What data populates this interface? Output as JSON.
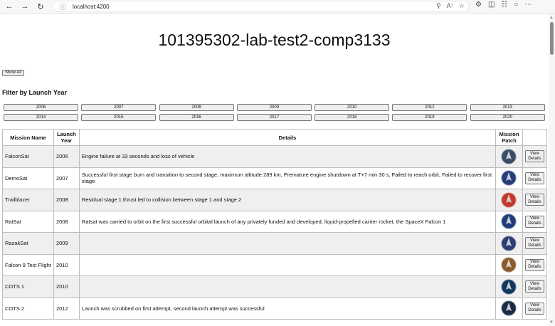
{
  "browser": {
    "url": "localhost:4200"
  },
  "page": {
    "title": "101395302-lab-test2-comp3133",
    "show_all_label": "Show All",
    "filter_heading": "Filter by Launch Year",
    "years": [
      "2006",
      "2007",
      "2008",
      "2009",
      "2010",
      "2012",
      "2013",
      "2014",
      "2015",
      "2016",
      "2017",
      "2018",
      "2019",
      "2020"
    ]
  },
  "table": {
    "headers": {
      "name": "Mission Name",
      "year_line1": "Launch",
      "year_line2": "Year",
      "details": "Details",
      "patch_line1": "Mission",
      "patch_line2": "Patch"
    },
    "view_label_line1": "View",
    "view_label_line2": "Details",
    "rows": [
      {
        "name": "FalconSat",
        "year": "2006",
        "details": "Engine failure at 33 seconds and loss of vehicle",
        "patch_color": "#3a4b66"
      },
      {
        "name": "DemoSat",
        "year": "2007",
        "details": "Successful first stage burn and transition to second stage, maximum altitude 289 km, Premature engine shutdown at T+7 min 30 s, Failed to reach orbit, Failed to recover first stage",
        "patch_color": "#263d7a"
      },
      {
        "name": "Trailblazer",
        "year": "2008",
        "details": "Residual stage 1 thrust led to collision between stage 1 and stage 2",
        "patch_color": "#c0392b"
      },
      {
        "name": "RatSat",
        "year": "2008",
        "details": "Ratsat was carried to orbit on the first successful orbital launch of any privately funded and developed, liquid-propelled carrier rocket, the SpaceX Falcon 1",
        "patch_color": "#1f3d7a"
      },
      {
        "name": "RazakSat",
        "year": "2009",
        "details": "",
        "patch_color": "#2c3e73"
      },
      {
        "name": "Falcon 9 Test Flight",
        "year": "2010",
        "details": "",
        "patch_color": "#8a5a2b"
      },
      {
        "name": "COTS 1",
        "year": "2010",
        "details": "",
        "patch_color": "#14365f"
      },
      {
        "name": "COTS 2",
        "year": "2012",
        "details": "Launch was scrubbed on first attempt, second launch attempt was successful",
        "patch_color": "#1a2a44"
      }
    ]
  }
}
